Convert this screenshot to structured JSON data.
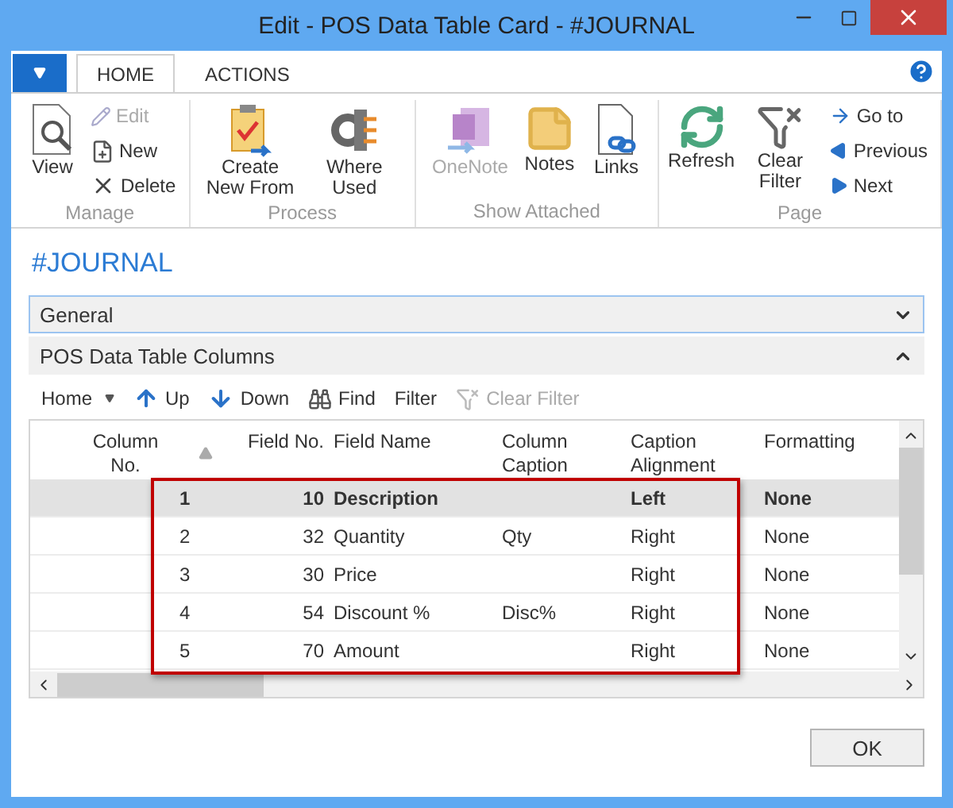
{
  "window": {
    "title": "Edit - POS Data Table Card - #JOURNAL"
  },
  "ribbon": {
    "tabs": [
      {
        "label": "HOME",
        "selected": true
      },
      {
        "label": "ACTIONS",
        "selected": false
      }
    ],
    "groups": [
      {
        "label": "Manage",
        "actions": [
          {
            "label": "View",
            "kind": "large",
            "disabled": false
          },
          {
            "label": "Edit",
            "kind": "small",
            "disabled": true
          },
          {
            "label": "New",
            "kind": "small",
            "disabled": false
          },
          {
            "label": "Delete",
            "kind": "small",
            "disabled": false
          }
        ]
      },
      {
        "label": "Process",
        "actions": [
          {
            "label": "Create New From",
            "kind": "large",
            "disabled": false
          },
          {
            "label": "Where Used",
            "kind": "large",
            "disabled": false
          }
        ]
      },
      {
        "label": "Show Attached",
        "actions": [
          {
            "label": "OneNote",
            "kind": "large",
            "disabled": true
          },
          {
            "label": "Notes",
            "kind": "large",
            "disabled": false
          },
          {
            "label": "Links",
            "kind": "large",
            "disabled": false
          }
        ]
      },
      {
        "label": "Page",
        "actions": [
          {
            "label": "Refresh",
            "kind": "large",
            "disabled": false
          },
          {
            "label": "Clear Filter",
            "kind": "large",
            "disabled": false
          },
          {
            "label": "Go to",
            "kind": "small",
            "disabled": false
          },
          {
            "label": "Previous",
            "kind": "small",
            "disabled": false
          },
          {
            "label": "Next",
            "kind": "small",
            "disabled": false
          }
        ]
      }
    ]
  },
  "page_title": "#JOURNAL",
  "fasttabs": [
    {
      "label": "General",
      "expanded": false
    },
    {
      "label": "POS Data Table Columns",
      "expanded": true
    }
  ],
  "toolbar": [
    {
      "label": "Home",
      "kind": "menu",
      "disabled": false
    },
    {
      "label": "Up",
      "kind": "up",
      "disabled": false
    },
    {
      "label": "Down",
      "kind": "down",
      "disabled": false
    },
    {
      "label": "Find",
      "kind": "find",
      "disabled": false
    },
    {
      "label": "Filter",
      "kind": "plain",
      "disabled": false
    },
    {
      "label": "Clear Filter",
      "kind": "clear",
      "disabled": true
    }
  ],
  "table": {
    "columns": [
      "Column No.",
      "Field No.",
      "Field Name",
      "Column Caption",
      "Caption Alignment",
      "Formatting"
    ],
    "rows": [
      {
        "cells": [
          "1",
          "10",
          "Description",
          "",
          "Left",
          "None"
        ],
        "selected": true
      },
      {
        "cells": [
          "2",
          "32",
          "Quantity",
          "Qty",
          "Right",
          "None"
        ],
        "selected": false
      },
      {
        "cells": [
          "3",
          "30",
          "Price",
          "",
          "Right",
          "None"
        ],
        "selected": false
      },
      {
        "cells": [
          "4",
          "54",
          "Discount %",
          "Disc%",
          "Right",
          "None"
        ],
        "selected": false
      },
      {
        "cells": [
          "5",
          "70",
          "Amount",
          "",
          "Right",
          "None"
        ],
        "selected": false
      }
    ]
  },
  "buttons": [
    "OK"
  ]
}
